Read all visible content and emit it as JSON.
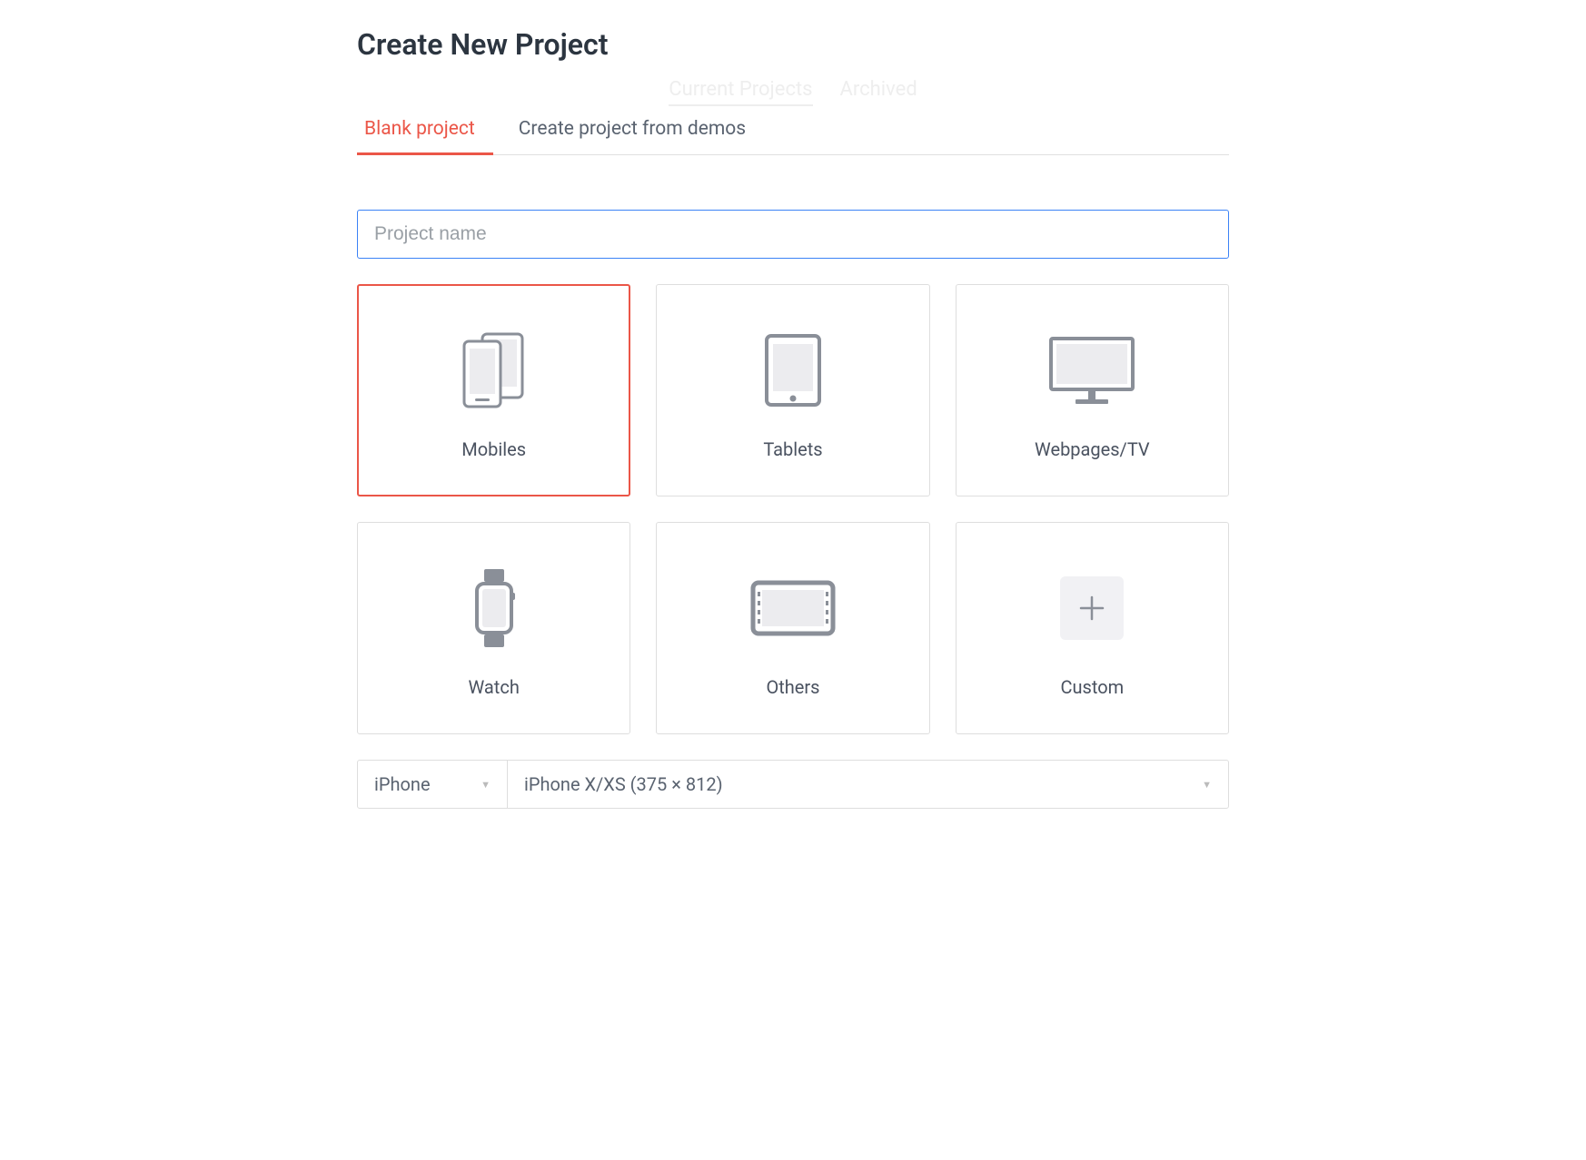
{
  "page": {
    "title": "Create New Project"
  },
  "ghost_tabs": {
    "current": "Current Projects",
    "archived": "Archived"
  },
  "tabs": {
    "blank": "Blank project",
    "demos": "Create project from demos"
  },
  "project_name": {
    "placeholder": "Project name",
    "value": ""
  },
  "devices": [
    {
      "id": "mobiles",
      "label": "Mobiles",
      "selected": true
    },
    {
      "id": "tablets",
      "label": "Tablets",
      "selected": false
    },
    {
      "id": "webpages-tv",
      "label": "Webpages/TV",
      "selected": false
    },
    {
      "id": "watch",
      "label": "Watch",
      "selected": false
    },
    {
      "id": "others",
      "label": "Others",
      "selected": false
    },
    {
      "id": "custom",
      "label": "Custom",
      "selected": false
    }
  ],
  "device_select": {
    "brand": "iPhone",
    "model": "iPhone X/XS (375 × 812)"
  }
}
